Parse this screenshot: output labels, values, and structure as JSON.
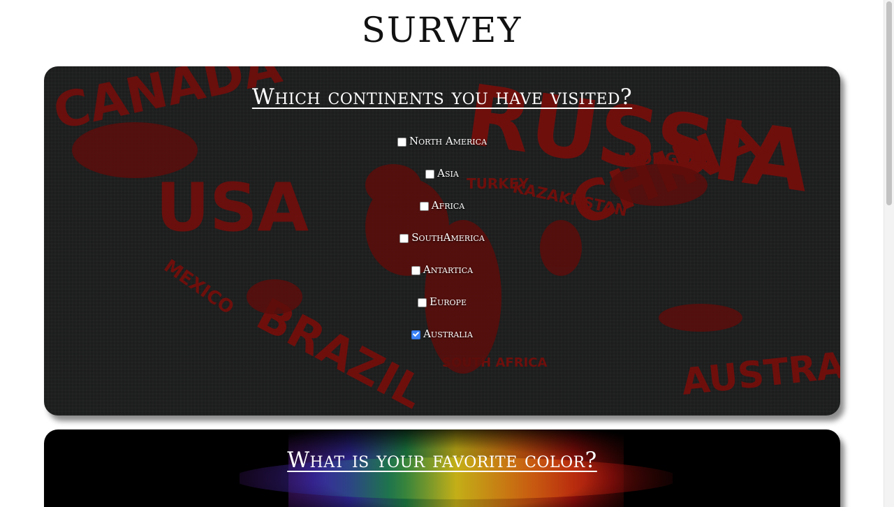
{
  "page": {
    "title": "SURVEY"
  },
  "continents_card": {
    "question": "Which continents you have visited?",
    "options": [
      {
        "label": "North America",
        "checked": false
      },
      {
        "label": "Asia",
        "checked": false
      },
      {
        "label": "Africa",
        "checked": false
      },
      {
        "label": "SouthAmerica",
        "checked": false
      },
      {
        "label": "Antartica",
        "checked": false
      },
      {
        "label": "Europe",
        "checked": false
      },
      {
        "label": "Australia",
        "checked": true
      }
    ],
    "background_words": [
      "CANADA",
      "USA",
      "RUSSIA",
      "CHINA",
      "BRAZIL",
      "AUSTRALIA",
      "MEXICO",
      "MONGOLIA",
      "KAZAKHSTAN",
      "TURKEY",
      "SOUTH AFRICA"
    ]
  },
  "color_card": {
    "question": "What is your favorite color?"
  },
  "colors": {
    "map_red": "#6e0f0c",
    "card_dark": "#1c1d1d",
    "checkbox_checked": "#3b82f6",
    "text_light": "#ffffff"
  }
}
